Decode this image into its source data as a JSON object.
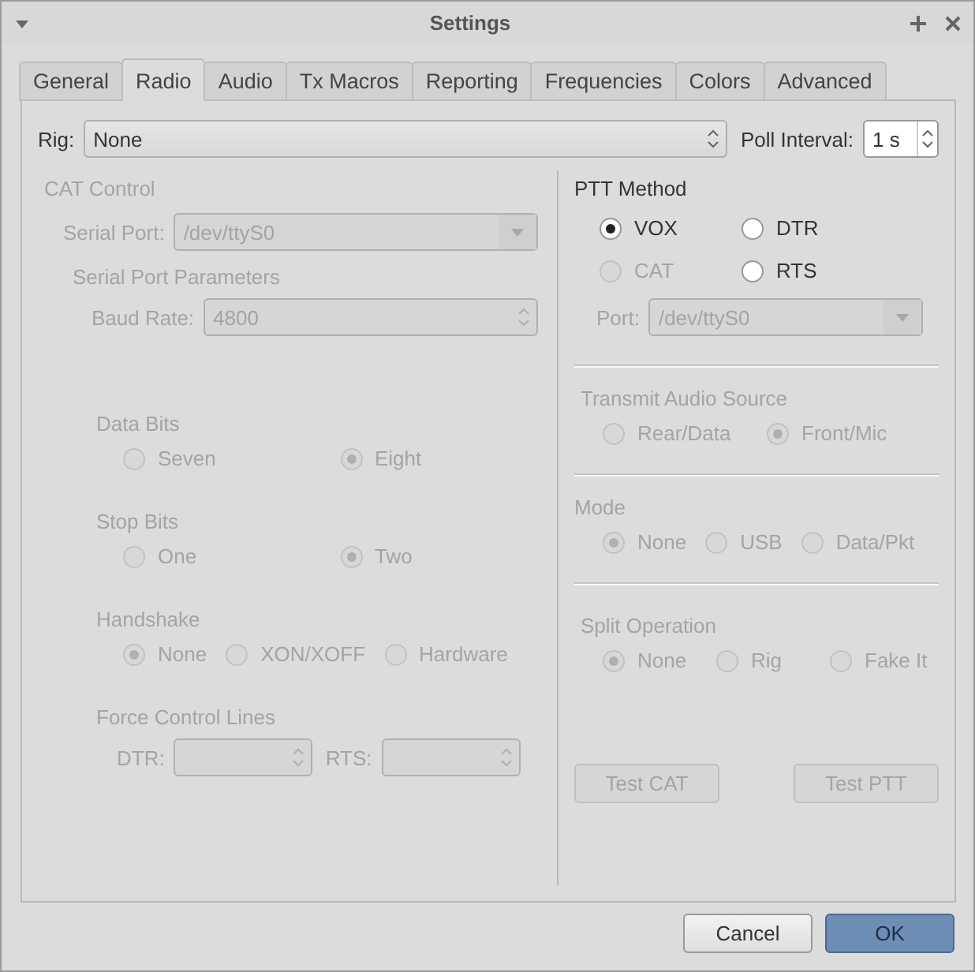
{
  "window": {
    "title": "Settings"
  },
  "tabs": [
    {
      "label": "General",
      "selected": false
    },
    {
      "label": "Radio",
      "selected": true
    },
    {
      "label": "Audio",
      "selected": false
    },
    {
      "label": "Tx Macros",
      "selected": false
    },
    {
      "label": "Reporting",
      "selected": false
    },
    {
      "label": "Frequencies",
      "selected": false
    },
    {
      "label": "Colors",
      "selected": false
    },
    {
      "label": "Advanced",
      "selected": false
    }
  ],
  "rig": {
    "label": "Rig:",
    "value": "None"
  },
  "poll_interval": {
    "label": "Poll Interval:",
    "value": "1 s"
  },
  "cat_control": {
    "title": "CAT Control",
    "disabled": true,
    "serial_port": {
      "label": "Serial Port:",
      "value": "/dev/ttyS0"
    },
    "parameters_title": "Serial Port Parameters",
    "baud_rate": {
      "label": "Baud Rate:",
      "value": "4800"
    },
    "groups": [
      {
        "title": "Data Bits",
        "options": [
          {
            "label": "Seven",
            "selected": false
          },
          {
            "label": "Eight",
            "selected": true
          }
        ]
      },
      {
        "title": "Stop Bits",
        "options": [
          {
            "label": "One",
            "selected": false
          },
          {
            "label": "Two",
            "selected": true
          }
        ]
      },
      {
        "title": "Handshake",
        "options": [
          {
            "label": "None",
            "selected": true
          },
          {
            "label": "XON/XOFF",
            "selected": false
          },
          {
            "label": "Hardware",
            "selected": false
          }
        ]
      }
    ],
    "force_control_lines": {
      "title": "Force Control Lines",
      "dtr_label": "DTR:",
      "rts_label": "RTS:"
    }
  },
  "ptt_method": {
    "title": "PTT Method",
    "options": [
      {
        "label": "VOX",
        "selected": true,
        "disabled": false
      },
      {
        "label": "DTR",
        "selected": false,
        "disabled": false
      },
      {
        "label": "CAT",
        "selected": false,
        "disabled": true
      },
      {
        "label": "RTS",
        "selected": false,
        "disabled": false
      }
    ],
    "port": {
      "label": "Port:",
      "value": "/dev/ttyS0",
      "disabled": true
    }
  },
  "right_groups": [
    {
      "title": "Transmit Audio Source",
      "disabled": true,
      "options": [
        {
          "label": "Rear/Data",
          "selected": false
        },
        {
          "label": "Front/Mic",
          "selected": true
        }
      ]
    },
    {
      "title": "Mode",
      "disabled": true,
      "options": [
        {
          "label": "None",
          "selected": true
        },
        {
          "label": "USB",
          "selected": false
        },
        {
          "label": "Data/Pkt",
          "selected": false
        }
      ]
    },
    {
      "title": "Split Operation",
      "disabled": true,
      "options": [
        {
          "label": "None",
          "selected": true
        },
        {
          "label": "Rig",
          "selected": false
        },
        {
          "label": "Fake It",
          "selected": false
        }
      ]
    }
  ],
  "test_buttons": [
    {
      "label": "Test CAT",
      "disabled": true
    },
    {
      "label": "Test PTT",
      "disabled": true
    }
  ],
  "buttons": [
    {
      "label": "Cancel",
      "kind": "normal"
    },
    {
      "label": "OK",
      "kind": "default"
    }
  ]
}
